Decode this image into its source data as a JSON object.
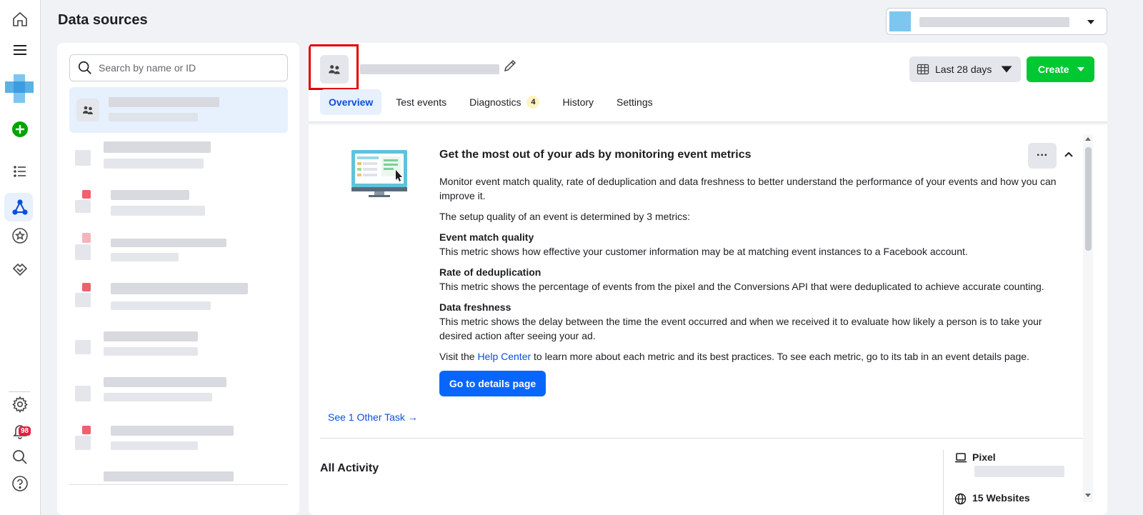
{
  "header": {
    "title": "Data sources"
  },
  "rail": {
    "notification_count": "98"
  },
  "search": {
    "placeholder": "Search by name or ID"
  },
  "main": {
    "date_range_label": "Last 28 days",
    "create_label": "Create",
    "tabs": [
      {
        "label": "Overview",
        "active": true
      },
      {
        "label": "Test events"
      },
      {
        "label": "Diagnostics",
        "badge": "4"
      },
      {
        "label": "History"
      },
      {
        "label": "Settings"
      }
    ]
  },
  "card": {
    "title": "Get the most out of your ads by monitoring event metrics",
    "intro_line1": "Monitor event match quality, rate of deduplication and data freshness to better understand the performance of your events and how you can",
    "intro_line2": "improve it.",
    "setup_text": "The setup quality of an event is determined by 3 metrics:",
    "metrics": [
      {
        "title": "Event match quality",
        "desc1": "This metric shows how effective your customer information may be at matching event instances to a Facebook account.",
        "desc2": ""
      },
      {
        "title": "Rate of deduplication",
        "desc1": "This metric shows the percentage of events from the pixel and the Conversions API that were deduplicated to achieve accurate counting.",
        "desc2": ""
      },
      {
        "title": "Data freshness",
        "desc1": "This metric shows the delay between the time the event occurred and when we received it to evaluate how likely a person is to take your",
        "desc2": "desired action after seeing your ad."
      }
    ],
    "visit_prefix": "Visit the ",
    "help_center": "Help Center",
    "visit_suffix": " to learn more about each metric and its best practices. To see each metric, go to its tab in an event details page.",
    "details_button": "Go to details page",
    "other_task": "See 1 Other Task →",
    "more_label": "···"
  },
  "activity": {
    "title": "All Activity",
    "pixel_label": "Pixel",
    "websites_label": "15 Websites"
  },
  "colors": {
    "accent_blue": "#0a4fdb",
    "create_green": "#00c832",
    "details_blue": "#0866ff",
    "highlight_red": "#e00000",
    "badge_red": "#e41e3f"
  },
  "icons": [
    "home-icon",
    "menu-icon",
    "add-icon",
    "list-icon",
    "data-sources-icon",
    "star-icon",
    "partner-icon",
    "gear-icon",
    "bell-icon",
    "search-icon",
    "help-icon",
    "pencil-icon",
    "calendar-icon",
    "chevron-up-icon"
  ]
}
